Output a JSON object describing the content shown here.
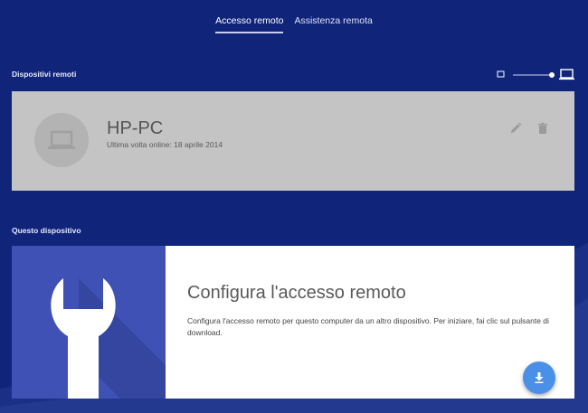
{
  "tabs": [
    {
      "label": "Accesso remoto",
      "active": true
    },
    {
      "label": "Assistenza remota",
      "active": false
    }
  ],
  "remote_devices": {
    "section_label": "Dispositivi remoti",
    "view_toggle": {
      "left_icon": "small-screen-icon",
      "right_icon": "laptop-icon",
      "selected": "laptop"
    },
    "device": {
      "name": "HP-PC",
      "status": "Ultima volta online: 18 aprile 2014",
      "avatar_icon": "laptop-icon",
      "actions": [
        "pencil-icon",
        "trash-icon"
      ]
    }
  },
  "this_device": {
    "section_label": "Questo dispositivo",
    "title": "Configura l'accesso remoto",
    "description": "Configura l'accesso remoto per questo computer da un altro dispositivo. Per iniziare, fai clic sul pulsante di download.",
    "art_icon": "wrench-icon",
    "download_icon": "download-icon"
  },
  "colors": {
    "background": "#10247a",
    "card_disabled": "#c4c4c4",
    "art_blue": "#3f51b5",
    "fab_blue": "#4a90e8"
  }
}
